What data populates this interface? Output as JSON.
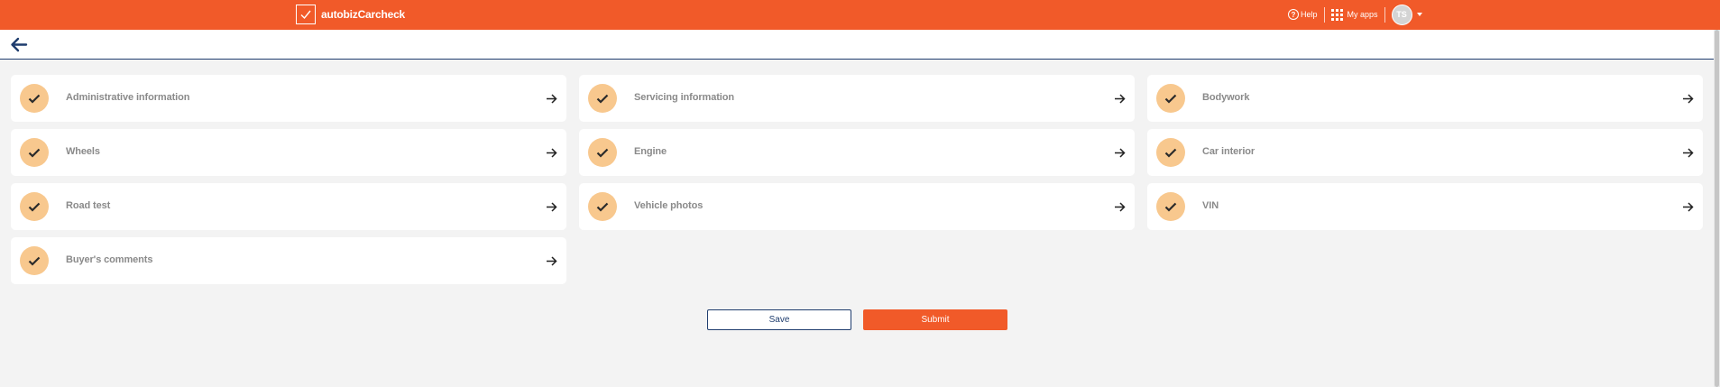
{
  "app": {
    "name": "autobizCarcheck",
    "help_label": "Help",
    "myapps_label": "My apps",
    "avatar_initials": "TS"
  },
  "colors": {
    "brand": "#f15a29",
    "navy": "#1f3d6e",
    "check_bg": "#f8c88e"
  },
  "sections": [
    {
      "label": "Administrative information",
      "status": "completed"
    },
    {
      "label": "Servicing information",
      "status": "completed"
    },
    {
      "label": "Bodywork",
      "status": "completed"
    },
    {
      "label": "Wheels",
      "status": "completed"
    },
    {
      "label": "Engine",
      "status": "completed"
    },
    {
      "label": "Car interior",
      "status": "completed"
    },
    {
      "label": "Road test",
      "status": "completed"
    },
    {
      "label": "Vehicle photos",
      "status": "completed"
    },
    {
      "label": "VIN",
      "status": "completed"
    },
    {
      "label": "Buyer's comments",
      "status": "completed"
    }
  ],
  "actions": {
    "save_label": "Save",
    "submit_label": "Submit"
  },
  "icons": {
    "logo": "checkbox-logo-icon",
    "help": "help-circle-icon",
    "apps": "apps-grid-icon",
    "back": "arrow-left-icon",
    "section_status": "check-icon",
    "section_open": "arrow-right-icon"
  }
}
